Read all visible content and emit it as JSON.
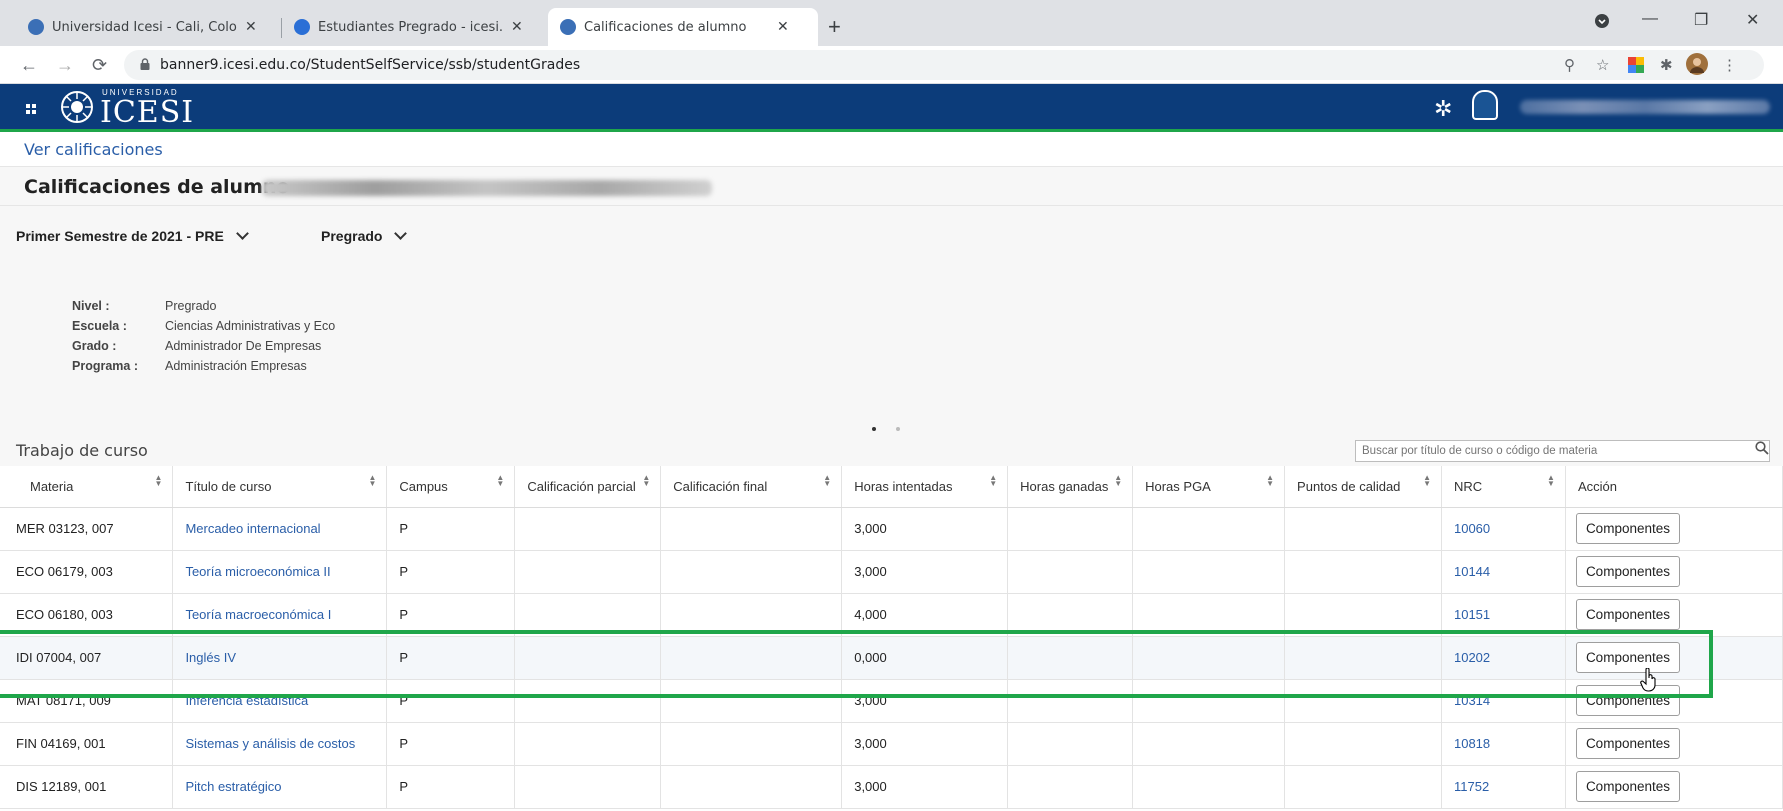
{
  "browser": {
    "tabs": [
      {
        "title": "Universidad Icesi - Cali, Colombia",
        "favicon_color": "#3b6fb6"
      },
      {
        "title": "Estudiantes Pregrado - icesi.edu.co",
        "favicon_color": "#2a6fd6"
      },
      {
        "title": "Calificaciones de alumno",
        "favicon_color": "#3b6fb6"
      }
    ],
    "url": "banner9.icesi.edu.co/StudentSelfService/ssb/studentGrades"
  },
  "header": {
    "logo_small": "UNIVERSIDAD",
    "logo_big": "ICESI",
    "bar_color": "#0c3c7a",
    "accent_color": "#1fa64a"
  },
  "breadcrumb": "Ver calificaciones",
  "page_title": "Calificaciones de alumno -",
  "filters": {
    "term": "Primer Semestre de 2021 - PRE",
    "level": "Pregrado"
  },
  "info": [
    {
      "label": "Nivel :",
      "value": "Pregrado"
    },
    {
      "label": "Escuela :",
      "value": "Ciencias Administrativas y Eco"
    },
    {
      "label": "Grado :",
      "value": "Administrador De Empresas"
    },
    {
      "label": "Programa :",
      "value": "Administración Empresas"
    }
  ],
  "coursework": {
    "title": "Trabajo de curso",
    "search_placeholder": "Buscar por título de curso o código de materia",
    "columns": [
      "Materia",
      "Título de curso",
      "Campus",
      "Calificación parcial",
      "Calificación final",
      "Horas intentadas",
      "Horas ganadas",
      "Horas PGA",
      "Puntos de calidad",
      "NRC",
      "Acción"
    ],
    "button_label": "Componentes",
    "rows": [
      {
        "materia": "MER 03123, 007",
        "titulo": "Mercadeo internacional",
        "campus": "P",
        "horas": "3,000",
        "nrc": "10060"
      },
      {
        "materia": "ECO 06179, 003",
        "titulo": "Teoría microeconómica II",
        "campus": "P",
        "horas": "3,000",
        "nrc": "10144"
      },
      {
        "materia": "ECO 06180, 003",
        "titulo": "Teoría macroeconómica I",
        "campus": "P",
        "horas": "4,000",
        "nrc": "10151"
      },
      {
        "materia": "IDI 07004, 007",
        "titulo": "Inglés IV",
        "campus": "P",
        "horas": "0,000",
        "nrc": "10202"
      },
      {
        "materia": "MAT 08171, 009",
        "titulo": "Inferencia estadística",
        "campus": "P",
        "horas": "3,000",
        "nrc": "10314"
      },
      {
        "materia": "FIN 04169, 001",
        "titulo": "Sistemas y análisis de costos",
        "campus": "P",
        "horas": "3,000",
        "nrc": "10818"
      },
      {
        "materia": "DIS 12189, 001",
        "titulo": "Pitch estratégico",
        "campus": "P",
        "horas": "3,000",
        "nrc": "11752"
      }
    ]
  }
}
